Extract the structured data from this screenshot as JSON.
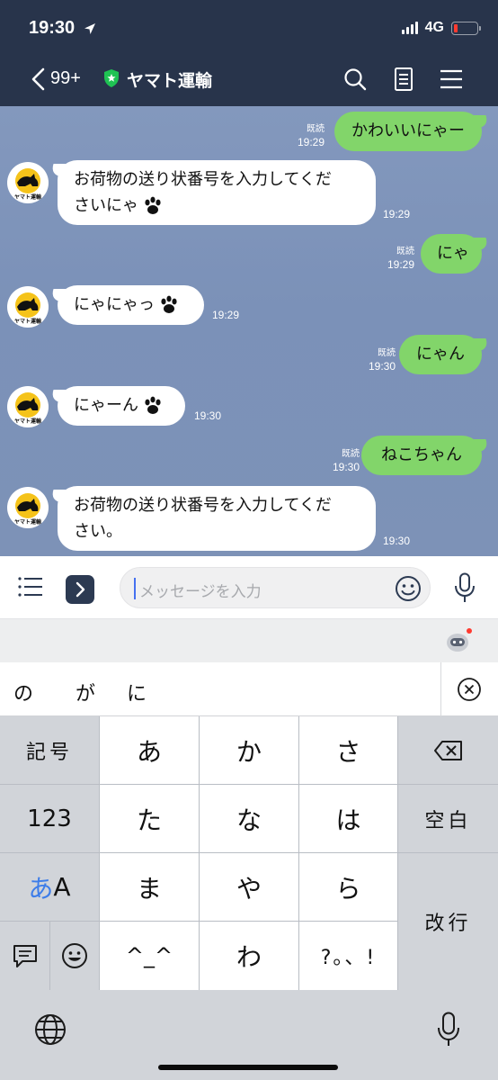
{
  "status_bar": {
    "time": "19:30",
    "network": "4G"
  },
  "header": {
    "unread_count": "99+",
    "title": "ヤマト運輸"
  },
  "messages": [
    {
      "dir": "out",
      "text": "かわいいにゃー",
      "read": "既読",
      "time": "19:29"
    },
    {
      "dir": "in",
      "line1": "お荷物の送り状番号を入力してくだ",
      "line2": "さいにゃ",
      "time": "19:29",
      "paws": true
    },
    {
      "dir": "out",
      "text": "にゃ",
      "read": "既読",
      "time": "19:29"
    },
    {
      "dir": "in",
      "line1": "にゃにゃっ",
      "time": "19:29",
      "paws": true
    },
    {
      "dir": "out",
      "text": "にゃん",
      "read": "既読",
      "time": "19:30"
    },
    {
      "dir": "in",
      "line1": "にゃーん",
      "time": "19:30",
      "paws": true
    },
    {
      "dir": "out",
      "text": "ねこちゃん",
      "read": "既読",
      "time": "19:30"
    },
    {
      "dir": "in",
      "line1": "お荷物の送り状番号を入力してくだ",
      "line2": "さい。",
      "time": "19:30"
    }
  ],
  "avatar_logo_text": "ヤマト運輸",
  "input": {
    "placeholder": "メッセージを入力"
  },
  "keyboard": {
    "candidates": [
      "の",
      "が",
      "に"
    ],
    "rows": [
      [
        "記号",
        "あ",
        "か",
        "さ",
        ""
      ],
      [
        "123",
        "た",
        "な",
        "は",
        "空白"
      ],
      [
        "あA",
        "ま",
        "や",
        "ら",
        "改行"
      ],
      [
        "",
        "",
        "^_^",
        "わ",
        "?。、!"
      ]
    ]
  },
  "colors": {
    "header_bg": "#28344b",
    "chat_bg": "#7f95ba",
    "outgoing_bubble": "#82d56a",
    "incoming_bubble": "#ffffff",
    "verified_badge": "#1fc253",
    "battery_low": "#ff3b30"
  },
  "icons": [
    "back-chevron-icon",
    "verified-shield-icon",
    "search-icon",
    "notes-icon",
    "hamburger-menu-icon",
    "list-menu-icon",
    "expand-chevron-icon",
    "emoji-icon",
    "microphone-icon",
    "robot-icon",
    "clear-icon",
    "delete-key-icon",
    "comment-icon",
    "smiley-key-icon",
    "globe-icon",
    "paw-icon"
  ]
}
